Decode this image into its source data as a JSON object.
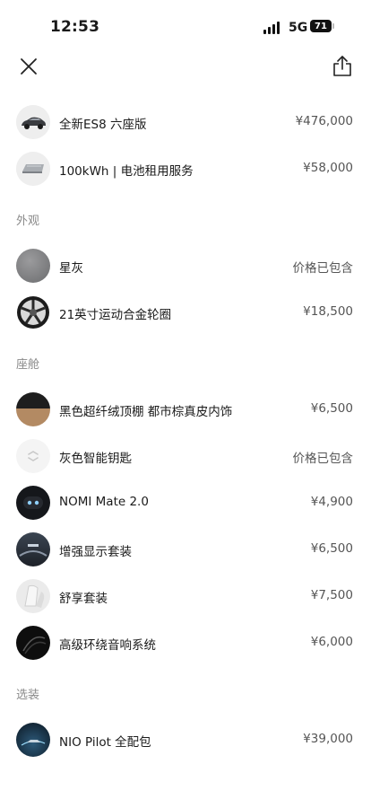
{
  "status": {
    "time": "12:53",
    "network": "5G",
    "battery": "71"
  },
  "items_top": [
    {
      "name": "全新ES8 六座版",
      "price": "¥476,000",
      "thumb": "car"
    },
    {
      "name": "100kWh | 电池租用服务",
      "price": "¥58,000",
      "thumb": "battery-pack"
    }
  ],
  "sections": [
    {
      "title": "外观",
      "items": [
        {
          "name": "星灰",
          "price": "价格已包含",
          "thumb": "gray-swatch"
        },
        {
          "name": "21英寸运动合金轮圈",
          "price": "¥18,500",
          "thumb": "wheel"
        }
      ]
    },
    {
      "title": "座舱",
      "items": [
        {
          "name": "黑色超纤绒顶棚 都市棕真皮内饰",
          "price": "¥6,500",
          "thumb": "interior-swatch"
        },
        {
          "name": "灰色智能钥匙",
          "price": "价格已包含",
          "thumb": "key"
        },
        {
          "name": "NOMI Mate 2.0",
          "price": "¥4,900",
          "thumb": "nomi"
        },
        {
          "name": "增强显示套装",
          "price": "¥6,500",
          "thumb": "display"
        },
        {
          "name": "舒享套装",
          "price": "¥7,500",
          "thumb": "comfort"
        },
        {
          "name": "高级环绕音响系统",
          "price": "¥6,000",
          "thumb": "audio"
        }
      ]
    },
    {
      "title": "选装",
      "items": [
        {
          "name": "NIO Pilot 全配包",
          "price": "¥39,000",
          "thumb": "pilot"
        }
      ]
    }
  ]
}
